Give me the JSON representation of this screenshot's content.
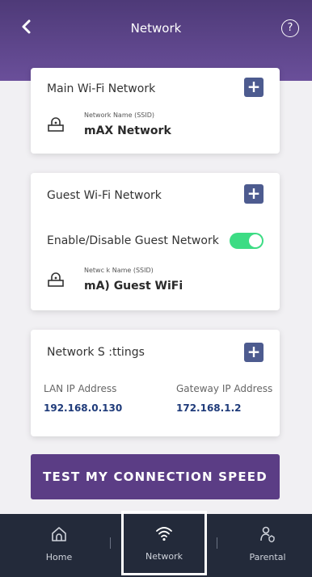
{
  "header": {
    "back_label": "‹",
    "title": "Network",
    "help_label": "?"
  },
  "main_wifi": {
    "title": "Main Wi-Fi Network",
    "plus_label": "+",
    "ssid_label": "Network Name (SSID)",
    "ssid_value": "mAX Network"
  },
  "guest_wifi": {
    "title": "Guest Wi-Fi Network",
    "plus_label": "+",
    "toggle_label": "Enable/Disable Guest Network",
    "toggle_on": true,
    "ssid_label": "Netwc k Name (SSID)",
    "ssid_value": "mA) Guest WiFi"
  },
  "network_settings": {
    "title": "Network S :ttings",
    "plus_label": "+",
    "lan_label": "LAN IP Address",
    "lan_value": "192.168.0.130",
    "gateway_label": "Gateway IP Address",
    "gateway_value": "172.168.1.2"
  },
  "test_button": {
    "label": "TEST MY CONNECTION SPEED"
  },
  "bottom_nav": {
    "items": [
      {
        "label": "Home",
        "icon": "home-icon"
      },
      {
        "label": "Network",
        "icon": "wifi-icon"
      },
      {
        "label": "Parental",
        "icon": "parental-icon"
      }
    ]
  },
  "colors": {
    "header": "#5a4287",
    "accent_button": "#5b3d85",
    "plus_button": "#4d5b8f",
    "toggle_on": "#3ddc84",
    "nav_bg": "#232a3a"
  }
}
